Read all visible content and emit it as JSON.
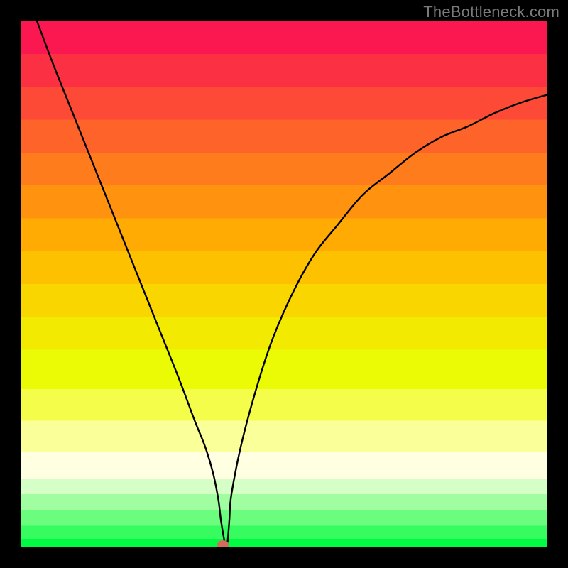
{
  "watermark": "TheBottleneck.com",
  "colors": {
    "frame": "#000000",
    "curve": "#000000",
    "marker": "#d66a5d",
    "gradient_stops": [
      "#fb1850",
      "#fc3043",
      "#fd4a36",
      "#fe6329",
      "#fe7c1c",
      "#ff930f",
      "#ffab03",
      "#fdc100",
      "#f9d600",
      "#f2ea01",
      "#eafb05",
      "#f3fd4a",
      "#fbff9a",
      "#ffffe2",
      "#d6ffc7",
      "#a0fea1",
      "#6bfd7e",
      "#36fc5f",
      "#00fb42"
    ]
  },
  "chart_data": {
    "type": "line",
    "title": "",
    "xlabel": "",
    "ylabel": "",
    "xlim": [
      0,
      100
    ],
    "ylim": [
      0,
      100
    ],
    "grid": false,
    "legend": false,
    "series": [
      {
        "name": "bottleneck-curve",
        "x": [
          3,
          6,
          10,
          14,
          18,
          22,
          26,
          30,
          33,
          35,
          36.5,
          37.5,
          38,
          38.8,
          39.2,
          39.6,
          40,
          42,
          45,
          48,
          52,
          56,
          60,
          65,
          70,
          75,
          80,
          85,
          90,
          95,
          100
        ],
        "y": [
          100,
          92,
          82,
          72,
          62,
          52,
          42,
          32,
          24,
          19,
          14,
          9,
          5,
          0.5,
          0.5,
          5,
          10,
          20,
          31,
          40,
          49,
          56,
          61,
          67,
          71,
          75,
          78,
          80,
          82.5,
          84.5,
          86
        ]
      }
    ],
    "marker": {
      "x": 38.4,
      "y": 0.4
    },
    "notes": "y is percent bottleneck (0 at bottom of plot, 100 at top). Background is a red→orange→yellow→green vertical gradient. The single black curve descends almost linearly from top-left, reaches ~0 near x≈38, then rises with a concave asymptotic shape toward ~86 at the right edge. A small reddish oval marker sits at the curve minimum."
  }
}
